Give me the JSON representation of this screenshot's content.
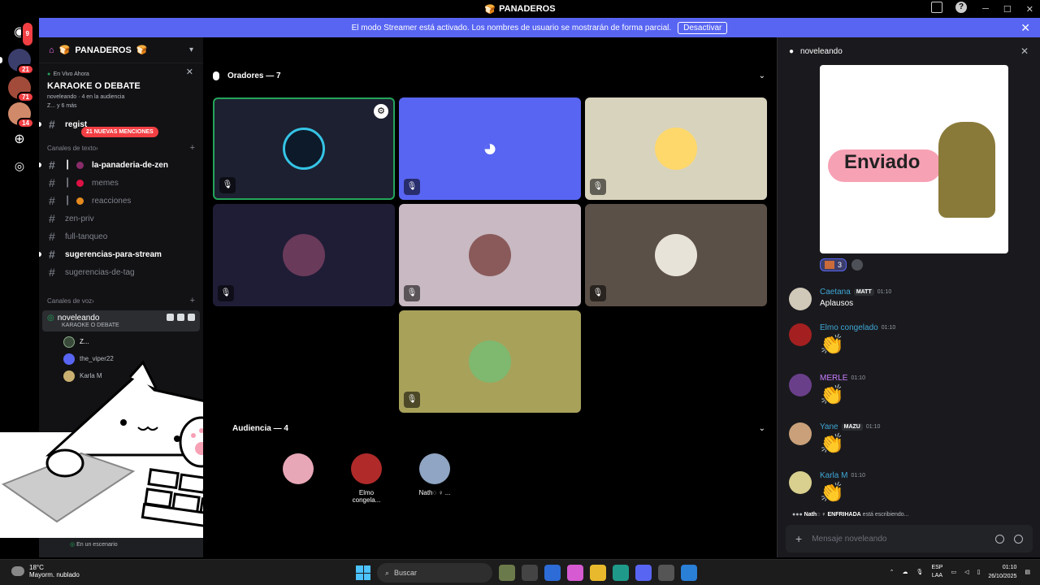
{
  "window": {
    "title": "PANADEROS"
  },
  "banner": {
    "text": "El modo Streamer está activado. Los nombres de usuario se mostrarán de forma parcial.",
    "button": "Desactivar"
  },
  "rail": {
    "dm_badge": "9",
    "badges": [
      "21",
      "71",
      "14"
    ]
  },
  "server": {
    "name": "PANADEROS"
  },
  "event": {
    "live_label": "En Vivo Ahora",
    "title": "KARAOKE O DEBATE",
    "host": "noveleando",
    "audience": "4 en la audiencia",
    "more": "Z... y 6 más"
  },
  "mentions_label": "21 NUEVAS MENCIONES",
  "channels_top": [
    {
      "name": "regist",
      "unread": true
    }
  ],
  "text_category": "Canales de texto",
  "text_channels": [
    {
      "name": "la-panaderia-de-zen",
      "unread": true,
      "prefix": "┃"
    },
    {
      "name": "memes",
      "unread": false,
      "prefix": "┃"
    },
    {
      "name": "reacciones",
      "unread": false,
      "prefix": "┃"
    },
    {
      "name": "zen-priv",
      "unread": false,
      "prefix": ""
    },
    {
      "name": "full-tanqueo",
      "unread": false,
      "prefix": ""
    },
    {
      "name": "sugerencias-para-stream",
      "unread": true,
      "prefix": ""
    },
    {
      "name": "sugerencias-de-tag",
      "unread": false,
      "prefix": ""
    }
  ],
  "voice_category": "Canales de voz",
  "voice_channel": {
    "name": "noveleando",
    "subtitle": "KARAOKE O DEBATE"
  },
  "voice_users": [
    {
      "name": "Z...",
      "color": "#3a4a3a"
    },
    {
      "name": "the_viper22",
      "color": "#5865f2"
    },
    {
      "name": "Karla M",
      "color": "#c9b070"
    }
  ],
  "user_panel": {
    "status": "En un escenario"
  },
  "stage": {
    "speakers_label": "Oradores — 7",
    "audience_label": "Audiencia — 4",
    "tiles": [
      {
        "bg": "#1d2030",
        "avatar": "#35c4e5",
        "speaking": true,
        "muted": true,
        "settings": true
      },
      {
        "bg": "#5865f2",
        "avatar": "discord",
        "speaking": false,
        "muted": true,
        "settings": false
      },
      {
        "bg": "#d8d3bc",
        "avatar": "#ffd86b",
        "speaking": false,
        "muted": true,
        "settings": false
      },
      {
        "bg": "#1f1d36",
        "avatar": "#6a3a5a",
        "speaking": false,
        "muted": true,
        "settings": false
      },
      {
        "bg": "#c8b9c2",
        "avatar": "#8a5a5a",
        "speaking": false,
        "muted": true,
        "settings": false
      },
      {
        "bg": "#5b5047",
        "avatar": "#e8e3d8",
        "speaking": false,
        "muted": true,
        "settings": false
      },
      {
        "bg": "#a8a15a",
        "avatar": "#7fb86f",
        "speaking": false,
        "muted": true,
        "settings": false
      }
    ],
    "audience": [
      {
        "name": "",
        "color": "#c96b3a"
      },
      {
        "name": "",
        "color": "#e8a7b7"
      },
      {
        "name": "Elmo congela...",
        "color": "#b02a2a"
      },
      {
        "name": "Nath◌ ♀ ...",
        "color": "#8fa5c3"
      }
    ]
  },
  "chat": {
    "title": "noveleando",
    "sticker_text": "Enviado",
    "reaction_count": "3",
    "messages": [
      {
        "name": "Caetana",
        "name_color": "#3fa7d6",
        "tag": "MATT",
        "time": "01:10",
        "text": "Aplausos",
        "clap": false,
        "av": "#d0c8b8"
      },
      {
        "name": "Elmo congelado",
        "name_color": "#3fa7d6",
        "tag": "",
        "time": "01:10",
        "text": "",
        "clap": true,
        "av": "#a42020"
      },
      {
        "name": "MERLE",
        "name_color": "#c77dff",
        "tag": "",
        "time": "01:10",
        "text": "",
        "clap": true,
        "av": "#6a3f8a"
      },
      {
        "name": "Yane",
        "name_color": "#3fa7d6",
        "tag": "MAZU",
        "time": "01:10",
        "text": "",
        "clap": true,
        "av": "#c9a07a"
      },
      {
        "name": "Karla M",
        "name_color": "#3fa7d6",
        "tag": "",
        "time": "01:10",
        "text": "",
        "clap": true,
        "av": "#d9cf8e"
      }
    ],
    "typing_user": "Nath◌ ♀ ENFRIHADA",
    "typing_suffix": "está escribiendo...",
    "placeholder": "Mensaje noveleando"
  },
  "taskbar": {
    "temp": "18°C",
    "weather": "Mayorm. nublado",
    "search": "Buscar",
    "lang1": "ESP",
    "lang2": "LAA",
    "time": "01:10",
    "date": "26/10/2025"
  }
}
